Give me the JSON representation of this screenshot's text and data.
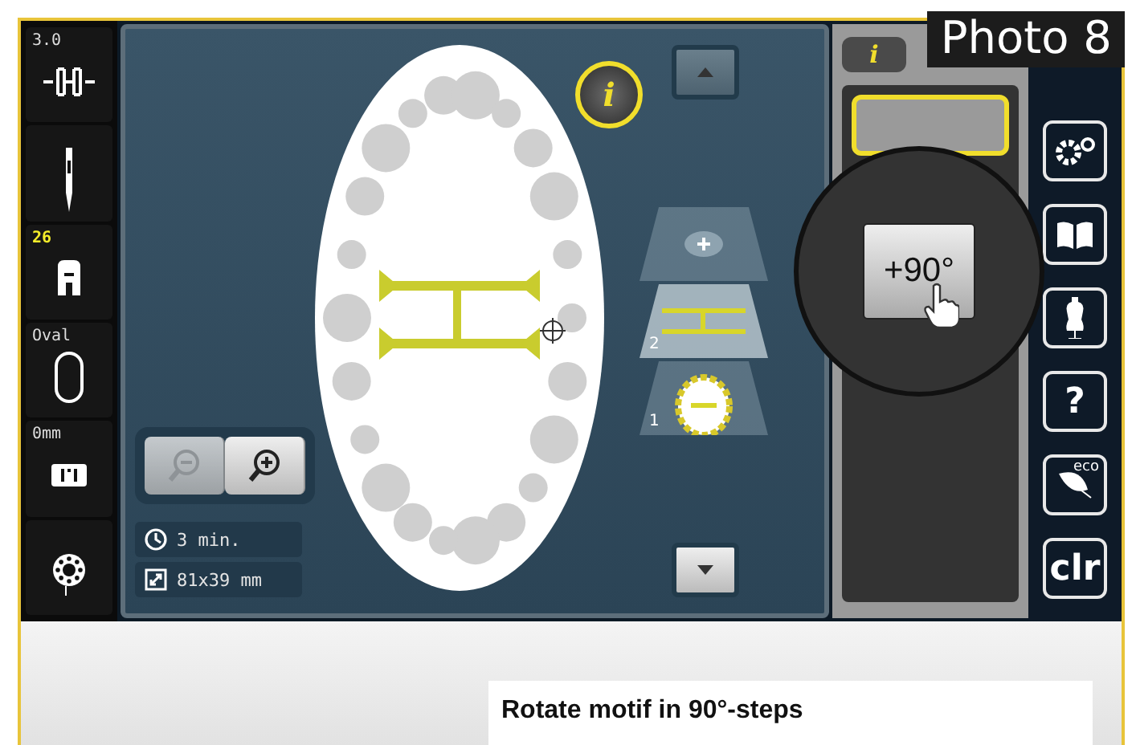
{
  "badge": "Photo 8",
  "sidebar": [
    {
      "kind": "stitch",
      "label": "3.0",
      "highlight": false
    },
    {
      "kind": "needle"
    },
    {
      "kind": "foot",
      "label": "26",
      "highlight": true
    },
    {
      "kind": "hoop",
      "label": "Oval",
      "highlight": false
    },
    {
      "kind": "feed",
      "label": "0mm",
      "highlight": false
    },
    {
      "kind": "bobbin"
    }
  ],
  "canvas": {
    "zoom_buttons": [
      {
        "kind": "out",
        "disabled": true
      },
      {
        "kind": "in",
        "disabled": false
      }
    ],
    "info": [
      {
        "kind": "time",
        "text": "3 min."
      },
      {
        "kind": "size",
        "text": "81x39 mm"
      }
    ]
  },
  "info_button": "i",
  "layers": [
    {
      "number": "2",
      "selected": true
    },
    {
      "number": "1",
      "selected": false
    }
  ],
  "panel_tabs": [
    {
      "label": "i",
      "selected": true
    }
  ],
  "magnifier": {
    "button": "+90°"
  },
  "toolbar": [
    {
      "kind": "setup"
    },
    {
      "kind": "tutorial"
    },
    {
      "kind": "consultant"
    },
    {
      "kind": "text",
      "text": "?"
    },
    {
      "kind": "eco",
      "text": "eco"
    },
    {
      "kind": "text",
      "text": "clr"
    }
  ],
  "caption": "Rotate motif in 90°-steps"
}
